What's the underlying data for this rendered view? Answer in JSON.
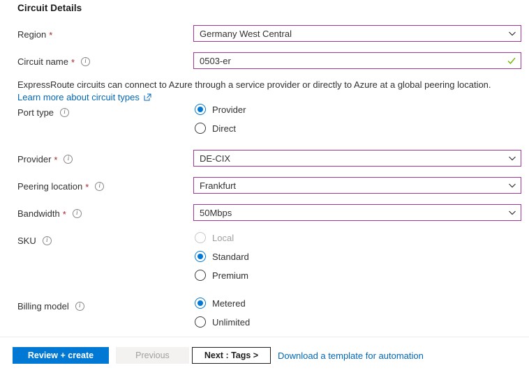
{
  "section": {
    "title": "Circuit Details"
  },
  "fields": {
    "region": {
      "label": "Region",
      "required": "*",
      "value": "Germany West Central",
      "control": "dropdown"
    },
    "circuit_name": {
      "label": "Circuit name",
      "required": "*",
      "value": "0503-er",
      "control": "textbox",
      "validation": "valid"
    },
    "provider": {
      "label": "Provider",
      "required": "*",
      "value": "DE-CIX",
      "control": "dropdown"
    },
    "peering_location": {
      "label": "Peering location",
      "required": "*",
      "value": "Frankfurt",
      "control": "dropdown"
    },
    "bandwidth": {
      "label": "Bandwidth",
      "required": "*",
      "value": "50Mbps",
      "control": "dropdown"
    }
  },
  "description": {
    "text": "ExpressRoute circuits can connect to Azure through a service provider or directly to Azure at a global peering location.",
    "link_label": "Learn more about circuit types",
    "link_icon": "external-link-icon"
  },
  "port_type": {
    "label": "Port type",
    "options": [
      {
        "label": "Provider",
        "selected": true,
        "disabled": false
      },
      {
        "label": "Direct",
        "selected": false,
        "disabled": false
      }
    ]
  },
  "sku": {
    "label": "SKU",
    "options": [
      {
        "label": "Local",
        "selected": false,
        "disabled": true
      },
      {
        "label": "Standard",
        "selected": true,
        "disabled": false
      },
      {
        "label": "Premium",
        "selected": false,
        "disabled": false
      }
    ]
  },
  "billing_model": {
    "label": "Billing model",
    "options": [
      {
        "label": "Metered",
        "selected": true,
        "disabled": false
      },
      {
        "label": "Unlimited",
        "selected": false,
        "disabled": false
      }
    ]
  },
  "footer": {
    "review_create_label": "Review + create",
    "previous_label": "Previous",
    "next_label": "Next : Tags >",
    "download_template_label": "Download a template for automation"
  },
  "colors": {
    "accent_blue": "#0078d4",
    "link_blue": "#0067b8",
    "field_border_purple": "#a4369a",
    "required_red": "#a4262c",
    "valid_green": "#6bb700",
    "disabled_gray": "#a19f9d"
  }
}
